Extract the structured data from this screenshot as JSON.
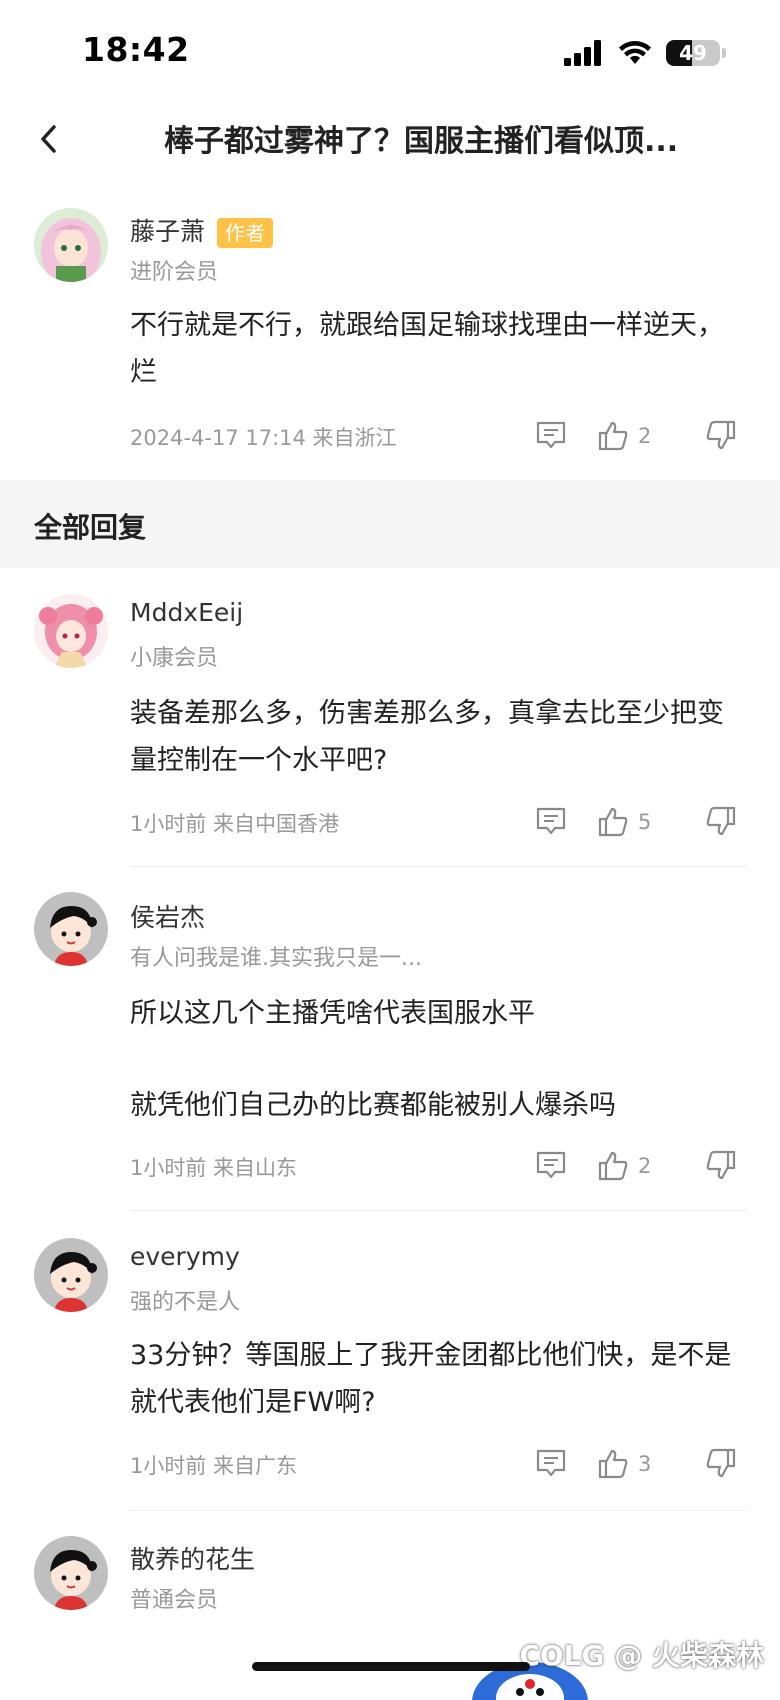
{
  "status_bar": {
    "time": "18:42",
    "battery_level": "49",
    "icons": [
      "cellular-signal-icon",
      "wifi-icon",
      "battery-icon"
    ]
  },
  "header": {
    "back_icon": "chevron-left-icon",
    "title": "棒子都过雾神了？国服主播们看似顶..."
  },
  "main_post": {
    "avatar": "anime-girl-avatar",
    "user_name": "藤子萧",
    "author_badge": "作者",
    "user_level": "进阶会员",
    "content": "不行就是不行，就跟给国足输球找理由一样逆天，烂",
    "meta": "2024-4-17 17:14  来自浙江",
    "likes": "2"
  },
  "section": {
    "title": "全部回复"
  },
  "replies": [
    {
      "avatar": "anime-girl-pink-avatar",
      "user_name": "MddxEeij",
      "user_level": "小康会员",
      "content": "装备差那么多，伤害差那么多，真拿去比至少把变量控制在一个水平吧?",
      "meta": "1小时前 来自中国香港",
      "likes": "5"
    },
    {
      "avatar": "default-cartoon-avatar",
      "user_name": "侯岩杰",
      "user_level": "有人问我是谁.其实我只是一...",
      "content_line1": "所以这几个主播凭啥代表国服水平",
      "content_line2": "就凭他们自己办的比赛都能被别人爆杀吗",
      "meta": "1小时前 来自山东",
      "likes": "2"
    },
    {
      "avatar": "default-cartoon-avatar",
      "user_name": "everymy",
      "user_level": "强的不是人",
      "content": "33分钟？等国服上了我开金团都比他们快，是不是就代表他们是FW啊?",
      "meta": "1小时前 来自广东",
      "likes": "3"
    },
    {
      "avatar": "default-cartoon-avatar",
      "user_name": "散养的花生",
      "user_level": "普通会员"
    }
  ],
  "actions": {
    "reply_icon": "comment-icon",
    "like_icon": "thumbs-up-icon",
    "dislike_icon": "thumbs-down-icon"
  },
  "watermark": "COLG @ 火柴森林",
  "colors": {
    "badge": "#ffc247",
    "muted_text": "#999999",
    "section_bg": "#f5f5f5"
  }
}
